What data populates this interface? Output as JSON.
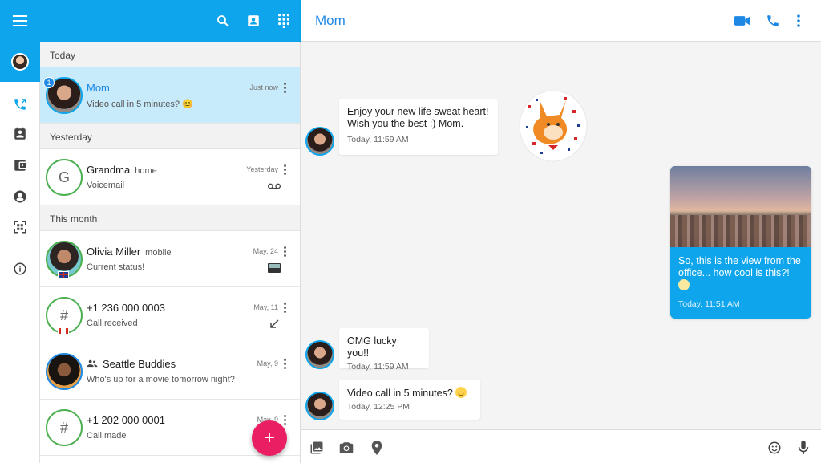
{
  "app": {
    "accent": "#0ea5ec",
    "fab_color": "#e91e63"
  },
  "rail": {
    "icons": [
      "menu-icon",
      "user-avatar",
      "call-log-icon",
      "contacts-icon",
      "wallet-icon",
      "account-icon",
      "qr-code-icon",
      "info-icon"
    ]
  },
  "list_header": {
    "icons": [
      "search-icon",
      "contact-card-icon",
      "dialpad-icon"
    ]
  },
  "sections": {
    "today": "Today",
    "yesterday": "Yesterday",
    "month": "This month"
  },
  "conversations": [
    {
      "name": "Mom",
      "type": "",
      "preview": "Video call in 5 minutes? 😊",
      "time": "Just now",
      "unread": "1"
    },
    {
      "name": "Grandma",
      "type": "home",
      "preview": "Voicemail",
      "time": "Yesterday",
      "initial": "G"
    },
    {
      "name": "Olivia Miller",
      "type": "mobile",
      "preview": "Current status!",
      "time": "May, 24"
    },
    {
      "name": "+1 236 000 0003",
      "type": "",
      "preview": "Call received",
      "time": "May, 11",
      "initial": "#"
    },
    {
      "name": "Seattle Buddies",
      "type": "",
      "preview": "Who's up for a movie tomorrow night?",
      "time": "May, 9"
    },
    {
      "name": "+1 202 000 0001",
      "type": "",
      "preview": "Call made",
      "time": "May, 9",
      "initial": "#"
    }
  ],
  "fab": {
    "label": "+"
  },
  "chat": {
    "title": "Mom",
    "messages": [
      {
        "text": "Enjoy your new life sweat heart!\nWish you the best :) Mom.",
        "time": "Today, 11:59 AM"
      },
      {
        "text": "So, this is the view from the office... how cool is this?!",
        "time": "Today, 11:51 AM"
      },
      {
        "text": "OMG lucky you!!",
        "time": "Today, 11:59 AM"
      },
      {
        "text": "Video call in 5 minutes?",
        "time": "Today, 12:25 PM"
      }
    ]
  },
  "composer": {
    "icons": [
      "gallery-icon",
      "camera-icon",
      "location-icon",
      "emoji-icon",
      "mic-icon"
    ]
  }
}
